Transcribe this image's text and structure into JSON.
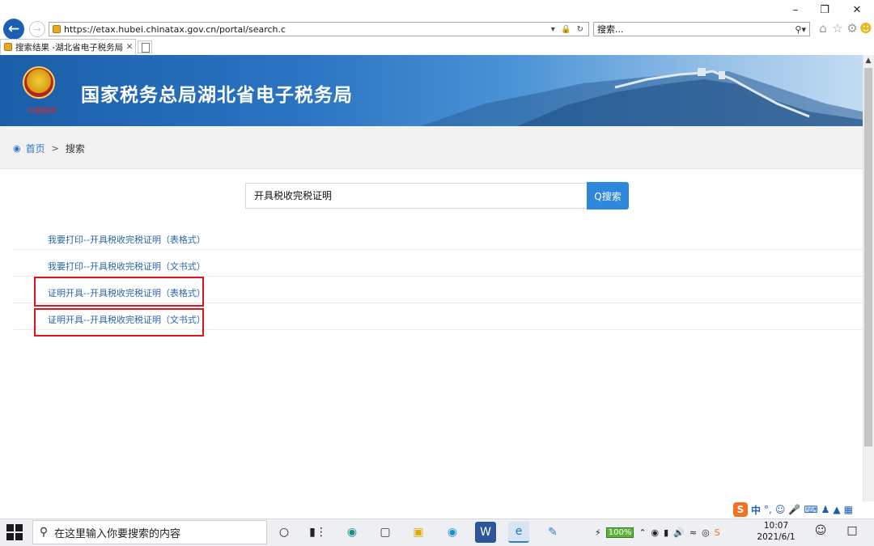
{
  "window": {
    "minimize": "–",
    "restore": "❐",
    "close": "✕"
  },
  "browser": {
    "back_icon": "left-arrow",
    "forward_icon": "right-arrow",
    "address_url": "https://etax.hubei.chinatax.gov.cn/portal/search.c",
    "address_controls": "▾ 🔒 ↻",
    "search_placeholder": "搜索...",
    "tab_title": "搜索结果 -湖北省电子税务局",
    "tab_close": "✕"
  },
  "banner": {
    "title": "国家税务总局湖北省电子税务局",
    "emblem_caption": "中国税务"
  },
  "breadcrumb": {
    "home": "首页",
    "separator": ">",
    "current": "搜索"
  },
  "search": {
    "query": "开具税收完税证明",
    "button_label": "Q搜索"
  },
  "results": [
    {
      "title": "我要打印--开具税收完税证明（表格式）"
    },
    {
      "title": "我要打印--开具税收完税证明（文书式）"
    },
    {
      "title": "证明开具--开具税收完税证明（表格式）"
    },
    {
      "title": "证明开具--开具税收完税证明（文书式）"
    }
  ],
  "ime": {
    "brand": "S",
    "mode": "中",
    "punct": "°,"
  },
  "taskbar": {
    "search_placeholder": "在这里输入你要搜索的内容",
    "battery": "100%",
    "time": "10:07",
    "date": "2021/6/1"
  }
}
